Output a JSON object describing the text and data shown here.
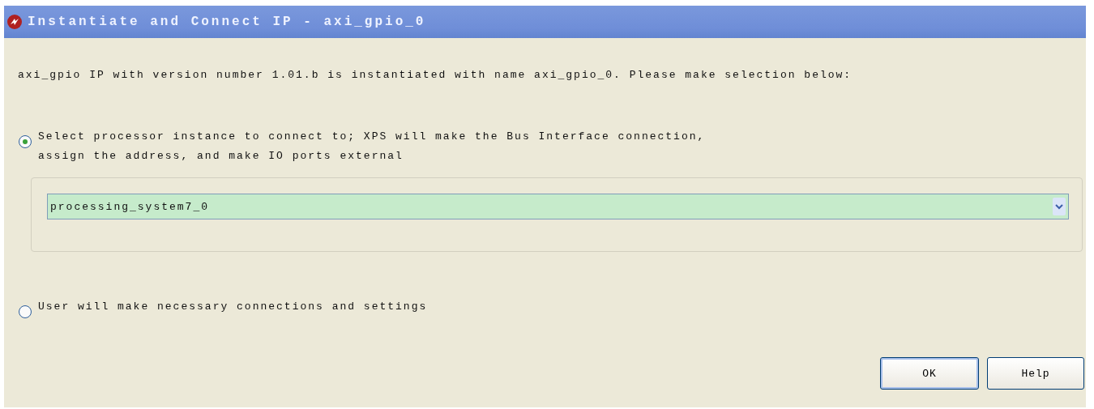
{
  "window": {
    "title": "Instantiate and Connect IP - axi_gpio_0"
  },
  "message": "axi_gpio IP with version number 1.01.b is instantiated with name axi_gpio_0. Please make selection below:",
  "options": [
    {
      "label_lines": [
        "Select processor instance to connect to; XPS will make the Bus Interface connection,",
        "assign the address, and make IO ports external"
      ],
      "selected": true,
      "processor": {
        "value": "processing_system7_0"
      }
    },
    {
      "label_lines": [
        "User will make necessary connections and settings"
      ],
      "selected": false
    }
  ],
  "buttons": [
    {
      "label": "OK",
      "default": true
    },
    {
      "label": "Help",
      "default": false
    }
  ]
}
